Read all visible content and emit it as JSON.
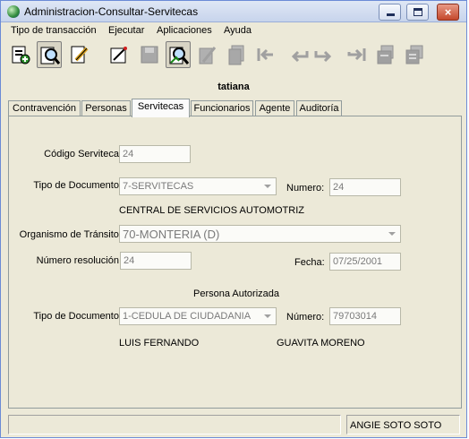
{
  "window": {
    "title": "Administracion-Consultar-Servitecas",
    "close_glyph": "×"
  },
  "menu": [
    "Tipo de transacción",
    "Ejecutar",
    "Aplicaciones",
    "Ayuda"
  ],
  "toolbar": {
    "icons": [
      "new-record-icon",
      "query-icon",
      "edit-icon",
      "execute-icon",
      "save-icon",
      "consult-icon",
      "delete-icon",
      "copy-icon",
      "first-record-icon",
      "previous-record-icon",
      "next-record-icon",
      "last-record-icon",
      "print-icon",
      "list-icon"
    ]
  },
  "user_label": "tatiana",
  "tabs": [
    "Contravención",
    "Personas",
    "Servitecas",
    "Funcionarios",
    "Agente",
    "Auditoría"
  ],
  "active_tab": "Servitecas",
  "form": {
    "codigo_label": "Código Serviteca:",
    "codigo_value": "24",
    "tipo_doc_label": "Tipo de Documento:",
    "tipo_doc_value": "7-SERVITECAS",
    "numero_label": "Numero:",
    "numero_value": "24",
    "serviteca_name": "CENTRAL DE SERVICIOS AUTOMOTRIZ",
    "organismo_label": "Organismo de Tránsito:",
    "organismo_value": "70-MONTERIA (D)",
    "resolucion_label": "Número resolución:",
    "resolucion_value": "24",
    "fecha_label": "Fecha:",
    "fecha_value": "07/25/2001",
    "persona_header": "Persona Autorizada",
    "persona_tipo_doc_label": "Tipo de Documento:",
    "persona_tipo_doc_value": "1-CEDULA DE CIUDADANIA",
    "persona_numero_label": "Número:",
    "persona_numero_value": "79703014",
    "persona_nombres": "LUIS FERNANDO",
    "persona_apellidos": "GUAVITA MORENO"
  },
  "status": {
    "left": "",
    "user": "ANGIE  SOTO SOTO"
  }
}
